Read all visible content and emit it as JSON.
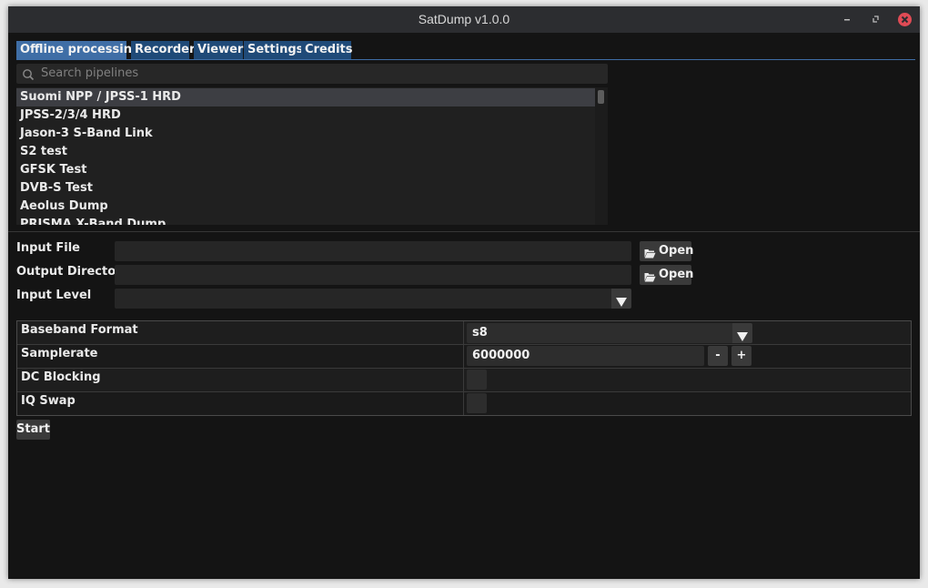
{
  "window": {
    "title": "SatDump v1.0.0"
  },
  "tabs": [
    {
      "label": "Offline processing"
    },
    {
      "label": "Recorder"
    },
    {
      "label": "Viewer"
    },
    {
      "label": "Settings"
    },
    {
      "label": "Credits"
    }
  ],
  "search": {
    "placeholder": "Search pipelines"
  },
  "pipelines": [
    {
      "label": "Suomi NPP / JPSS-1 HRD"
    },
    {
      "label": "JPSS-2/3/4 HRD"
    },
    {
      "label": "Jason-3 S-Band Link"
    },
    {
      "label": "S2 test"
    },
    {
      "label": "GFSK Test"
    },
    {
      "label": "DVB-S Test"
    },
    {
      "label": "Aeolus Dump"
    },
    {
      "label": "PRISMA X-Band Dump"
    }
  ],
  "form": {
    "input_file_label": "Input File",
    "output_dir_label": "Output Directory",
    "input_level_label": "Input Level",
    "open_label": "Open",
    "input_file_value": "",
    "output_dir_value": "",
    "input_level_value": ""
  },
  "params": {
    "baseband_format_label": "Baseband Format",
    "baseband_format_value": "s8",
    "samplerate_label": "Samplerate",
    "samplerate_value": "6000000",
    "minus_label": "-",
    "plus_label": "+",
    "dc_blocking_label": "DC Blocking",
    "dc_blocking_checked": false,
    "iq_swap_label": "IQ Swap",
    "iq_swap_checked": false
  },
  "start_label": "Start",
  "colors": {
    "tab_active": "#3f6ea6",
    "tab_inactive": "#1f4a78",
    "close_button": "#e04b55"
  }
}
